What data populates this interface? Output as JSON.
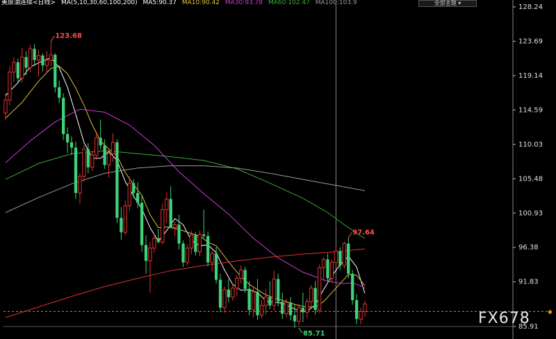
{
  "header": {
    "title": "美原油连续<日线>",
    "ma_label": "MA(5,10,30,60,100,200)",
    "ma5": "MA5:90.37",
    "ma10": "MA10:90.42",
    "ma30": "MA30:93.78",
    "ma60": "MA60:102.47",
    "ma100": "MA100:103.9",
    "select_label": "全部主题 ▾"
  },
  "watermark": "FX678",
  "colors": {
    "up": "#e63232",
    "down": "#3fd27a",
    "ma5": "#ffffff",
    "ma10": "#e0c23a",
    "ma30": "#d23ad2",
    "ma60": "#3aaa3a",
    "ma100": "#9a9a9a",
    "ma200": "#e03030",
    "axis": "#e0e0e0",
    "price_line": "#d98a1c"
  },
  "chart_data": {
    "type": "candlestick",
    "title": "美原油连续<日线>",
    "y_ticks": [
      "128.24",
      "123.69",
      "119.14",
      "114.59",
      "110.03",
      "105.48",
      "100.93",
      "96.38",
      "91.83",
      "85.91"
    ],
    "ylim": [
      85.91,
      128.24
    ],
    "annotations": [
      {
        "text": "123.68",
        "value": 123.68,
        "index": 11,
        "kind": "high"
      },
      {
        "text": "97.64",
        "value": 97.64,
        "index": 83,
        "kind": "high"
      },
      {
        "text": "85.71",
        "value": 85.71,
        "index": 71,
        "kind": "low"
      }
    ],
    "current_price": 87.9,
    "crosshair_index": 80,
    "candles": [
      [
        114.2,
        116.8,
        113.2,
        115.9
      ],
      [
        115.9,
        120.4,
        115.2,
        119.6
      ],
      [
        119.6,
        121.6,
        118.3,
        120.9
      ],
      [
        120.9,
        121.4,
        118.1,
        118.8
      ],
      [
        118.8,
        122.8,
        118.2,
        121.6
      ],
      [
        121.6,
        122.4,
        119.2,
        120.2
      ],
      [
        120.2,
        123.2,
        119.6,
        122.7
      ],
      [
        122.7,
        123.3,
        120.4,
        121.2
      ],
      [
        121.2,
        122.6,
        119.0,
        121.8
      ],
      [
        121.8,
        122.1,
        119.7,
        120.5
      ],
      [
        120.5,
        122.4,
        119.5,
        121.2
      ],
      [
        121.2,
        123.68,
        120.4,
        121.9
      ],
      [
        121.9,
        122.1,
        116.9,
        117.6
      ],
      [
        117.6,
        118.5,
        115.5,
        116.2
      ],
      [
        116.2,
        116.8,
        110.6,
        111.4
      ],
      [
        111.4,
        112.3,
        108.9,
        110.3
      ],
      [
        110.3,
        111.1,
        108.6,
        109.6
      ],
      [
        109.6,
        110.4,
        102.8,
        103.6
      ],
      [
        103.6,
        106.2,
        102.2,
        105.8
      ],
      [
        105.8,
        109.9,
        105.1,
        109.4
      ],
      [
        109.4,
        110.2,
        106.2,
        107.0
      ],
      [
        107.0,
        109.0,
        106.5,
        108.6
      ],
      [
        108.6,
        111.5,
        108.0,
        110.9
      ],
      [
        110.9,
        113.3,
        109.4,
        109.9
      ],
      [
        109.9,
        110.7,
        106.8,
        107.3
      ],
      [
        107.3,
        109.4,
        105.6,
        108.8
      ],
      [
        108.8,
        111.5,
        107.7,
        110.3
      ],
      [
        110.3,
        110.7,
        99.6,
        100.3
      ],
      [
        100.3,
        101.7,
        97.4,
        98.4
      ],
      [
        98.4,
        102.6,
        98.0,
        101.9
      ],
      [
        101.9,
        105.8,
        101.2,
        104.9
      ],
      [
        104.9,
        105.4,
        102.9,
        103.6
      ],
      [
        103.6,
        105.0,
        101.6,
        102.3
      ],
      [
        102.3,
        103.2,
        95.8,
        96.7
      ],
      [
        96.7,
        98.0,
        92.9,
        94.6
      ],
      [
        94.6,
        97.1,
        90.4,
        96.3
      ],
      [
        96.3,
        98.2,
        95.7,
        97.6
      ],
      [
        97.6,
        98.8,
        96.9,
        97.1
      ],
      [
        97.1,
        102.2,
        96.8,
        101.4
      ],
      [
        101.4,
        103.7,
        99.6,
        102.8
      ],
      [
        102.8,
        104.5,
        102.0,
        99.0
      ],
      [
        99.0,
        99.8,
        97.9,
        99.4
      ],
      [
        99.4,
        100.7,
        96.1,
        96.9
      ],
      [
        96.9,
        97.3,
        93.8,
        94.4
      ],
      [
        94.4,
        96.8,
        94.0,
        96.3
      ],
      [
        96.3,
        98.6,
        95.5,
        98.0
      ],
      [
        98.0,
        98.4,
        95.3,
        95.8
      ],
      [
        95.8,
        98.6,
        95.2,
        98.1
      ],
      [
        98.1,
        101.4,
        97.6,
        97.9
      ],
      [
        97.9,
        98.5,
        93.9,
        94.4
      ],
      [
        94.4,
        95.9,
        93.2,
        95.6
      ],
      [
        95.6,
        96.4,
        91.6,
        92.1
      ],
      [
        92.1,
        92.9,
        87.8,
        88.4
      ],
      [
        88.4,
        91.2,
        87.7,
        90.8
      ],
      [
        90.8,
        92.2,
        89.1,
        89.8
      ],
      [
        89.8,
        91.6,
        89.3,
        91.0
      ],
      [
        91.0,
        92.7,
        89.9,
        92.3
      ],
      [
        92.3,
        94.0,
        91.6,
        93.4
      ],
      [
        93.4,
        93.8,
        90.4,
        90.9
      ],
      [
        90.9,
        91.9,
        87.4,
        88.1
      ],
      [
        88.1,
        91.2,
        87.1,
        90.5
      ],
      [
        90.5,
        92.2,
        86.8,
        87.4
      ],
      [
        87.4,
        89.4,
        87.0,
        88.7
      ],
      [
        88.7,
        90.9,
        87.5,
        89.8
      ],
      [
        89.8,
        91.9,
        88.2,
        88.7
      ],
      [
        88.7,
        93.3,
        88.0,
        92.2
      ],
      [
        92.2,
        92.9,
        88.6,
        89.2
      ],
      [
        89.2,
        90.4,
        86.9,
        87.6
      ],
      [
        87.6,
        89.6,
        87.1,
        89.1
      ],
      [
        89.1,
        89.8,
        86.7,
        87.4
      ],
      [
        87.4,
        88.8,
        85.71,
        86.6
      ],
      [
        86.6,
        88.9,
        86.1,
        88.4
      ],
      [
        88.4,
        90.4,
        86.5,
        87.8
      ],
      [
        87.8,
        89.6,
        87.0,
        89.2
      ],
      [
        89.2,
        91.4,
        88.6,
        91.0
      ],
      [
        91.0,
        91.9,
        87.5,
        88.1
      ],
      [
        88.1,
        94.1,
        87.7,
        93.7
      ],
      [
        93.7,
        95.1,
        91.9,
        94.8
      ],
      [
        94.8,
        95.6,
        91.6,
        92.3
      ],
      [
        92.3,
        94.8,
        91.7,
        94.4
      ],
      [
        94.4,
        96.4,
        93.8,
        95.9
      ],
      [
        95.9,
        96.4,
        93.4,
        94.0
      ],
      [
        94.0,
        97.2,
        93.6,
        96.9
      ],
      [
        96.9,
        97.64,
        92.3,
        92.9
      ],
      [
        92.9,
        93.4,
        88.8,
        89.4
      ],
      [
        89.4,
        90.2,
        86.2,
        86.9
      ],
      [
        86.9,
        88.4,
        86.2,
        87.9
      ],
      [
        87.9,
        89.3,
        87.2,
        88.9
      ]
    ],
    "ma_series": [
      {
        "name": "MA5",
        "color": "#ffffff",
        "points": [
          [
            0,
            116.5
          ],
          [
            3,
            118.2
          ],
          [
            6,
            120.3
          ],
          [
            9,
            121.1
          ],
          [
            11,
            121.5
          ],
          [
            13,
            120.2
          ],
          [
            15,
            117.6
          ],
          [
            17,
            114.0
          ],
          [
            19,
            110.3
          ],
          [
            21,
            108.2
          ],
          [
            23,
            108.2
          ],
          [
            25,
            109.1
          ],
          [
            27,
            107.9
          ],
          [
            29,
            105.1
          ],
          [
            31,
            103.2
          ],
          [
            33,
            101.5
          ],
          [
            35,
            99.0
          ],
          [
            37,
            97.2
          ],
          [
            39,
            98.6
          ],
          [
            41,
            100.2
          ],
          [
            43,
            99.4
          ],
          [
            45,
            97.3
          ],
          [
            47,
            96.6
          ],
          [
            49,
            96.7
          ],
          [
            51,
            95.7
          ],
          [
            53,
            93.4
          ],
          [
            55,
            91.5
          ],
          [
            57,
            90.7
          ],
          [
            59,
            90.8
          ],
          [
            61,
            90.4
          ],
          [
            63,
            89.3
          ],
          [
            65,
            89.1
          ],
          [
            67,
            89.0
          ],
          [
            69,
            88.5
          ],
          [
            71,
            88.0
          ],
          [
            73,
            87.9
          ],
          [
            75,
            88.8
          ],
          [
            77,
            90.8
          ],
          [
            79,
            92.6
          ],
          [
            81,
            94.1
          ],
          [
            83,
            95.2
          ],
          [
            85,
            93.8
          ],
          [
            87,
            90.3
          ]
        ]
      },
      {
        "name": "MA10",
        "color": "#e0c23a",
        "points": [
          [
            0,
            113.5
          ],
          [
            4,
            115.6
          ],
          [
            8,
            118.4
          ],
          [
            11,
            120.1
          ],
          [
            13,
            120.4
          ],
          [
            15,
            119.4
          ],
          [
            17,
            117.5
          ],
          [
            19,
            115.2
          ],
          [
            21,
            112.6
          ],
          [
            23,
            110.5
          ],
          [
            25,
            109.4
          ],
          [
            27,
            108.5
          ],
          [
            29,
            106.3
          ],
          [
            31,
            104.7
          ],
          [
            33,
            103.3
          ],
          [
            35,
            100.7
          ],
          [
            37,
            99.0
          ],
          [
            39,
            99.1
          ],
          [
            41,
            98.9
          ],
          [
            43,
            98.6
          ],
          [
            45,
            98.2
          ],
          [
            47,
            97.9
          ],
          [
            49,
            97.1
          ],
          [
            51,
            96.6
          ],
          [
            53,
            95.2
          ],
          [
            55,
            93.8
          ],
          [
            57,
            92.5
          ],
          [
            59,
            91.5
          ],
          [
            61,
            90.8
          ],
          [
            63,
            90.1
          ],
          [
            65,
            89.7
          ],
          [
            67,
            89.4
          ],
          [
            69,
            89.0
          ],
          [
            71,
            88.7
          ],
          [
            73,
            88.5
          ],
          [
            75,
            88.5
          ],
          [
            77,
            89.2
          ],
          [
            79,
            90.4
          ],
          [
            81,
            91.6
          ],
          [
            83,
            92.8
          ],
          [
            85,
            92.7
          ],
          [
            87,
            91.3
          ]
        ]
      },
      {
        "name": "MA30",
        "color": "#d23ad2",
        "points": [
          [
            0,
            107.6
          ],
          [
            6,
            110.5
          ],
          [
            12,
            113.0
          ],
          [
            18,
            114.7
          ],
          [
            24,
            114.3
          ],
          [
            30,
            112.6
          ],
          [
            36,
            109.9
          ],
          [
            42,
            106.4
          ],
          [
            48,
            103.5
          ],
          [
            54,
            100.8
          ],
          [
            60,
            97.6
          ],
          [
            66,
            95.0
          ],
          [
            72,
            93.1
          ],
          [
            78,
            91.9
          ],
          [
            82,
            91.6
          ],
          [
            84,
            91.7
          ],
          [
            86,
            91.3
          ],
          [
            87,
            91.0
          ]
        ]
      },
      {
        "name": "MA60",
        "color": "#3aaa3a",
        "points": [
          [
            0,
            105.4
          ],
          [
            8,
            107.5
          ],
          [
            16,
            108.8
          ],
          [
            24,
            109.2
          ],
          [
            32,
            108.8
          ],
          [
            40,
            108.4
          ],
          [
            48,
            107.9
          ],
          [
            56,
            106.8
          ],
          [
            64,
            104.9
          ],
          [
            72,
            102.9
          ],
          [
            78,
            101.0
          ],
          [
            82,
            99.4
          ],
          [
            86,
            97.9
          ],
          [
            87,
            97.6
          ]
        ]
      },
      {
        "name": "MA100",
        "color": "#9a9a9a",
        "points": [
          [
            0,
            101.0
          ],
          [
            8,
            103.0
          ],
          [
            16,
            104.8
          ],
          [
            24,
            106.2
          ],
          [
            32,
            106.9
          ],
          [
            40,
            107.2
          ],
          [
            48,
            107.2
          ],
          [
            56,
            106.9
          ],
          [
            64,
            106.2
          ],
          [
            72,
            105.4
          ],
          [
            80,
            104.6
          ],
          [
            87,
            103.9
          ]
        ]
      },
      {
        "name": "MA200",
        "color": "#e03030",
        "points": [
          [
            0,
            87.1
          ],
          [
            8,
            88.5
          ],
          [
            16,
            89.9
          ],
          [
            24,
            91.2
          ],
          [
            32,
            92.3
          ],
          [
            40,
            93.3
          ],
          [
            48,
            94.0
          ],
          [
            56,
            94.6
          ],
          [
            64,
            95.1
          ],
          [
            72,
            95.5
          ],
          [
            80,
            95.8
          ],
          [
            87,
            96.2
          ]
        ]
      }
    ]
  }
}
